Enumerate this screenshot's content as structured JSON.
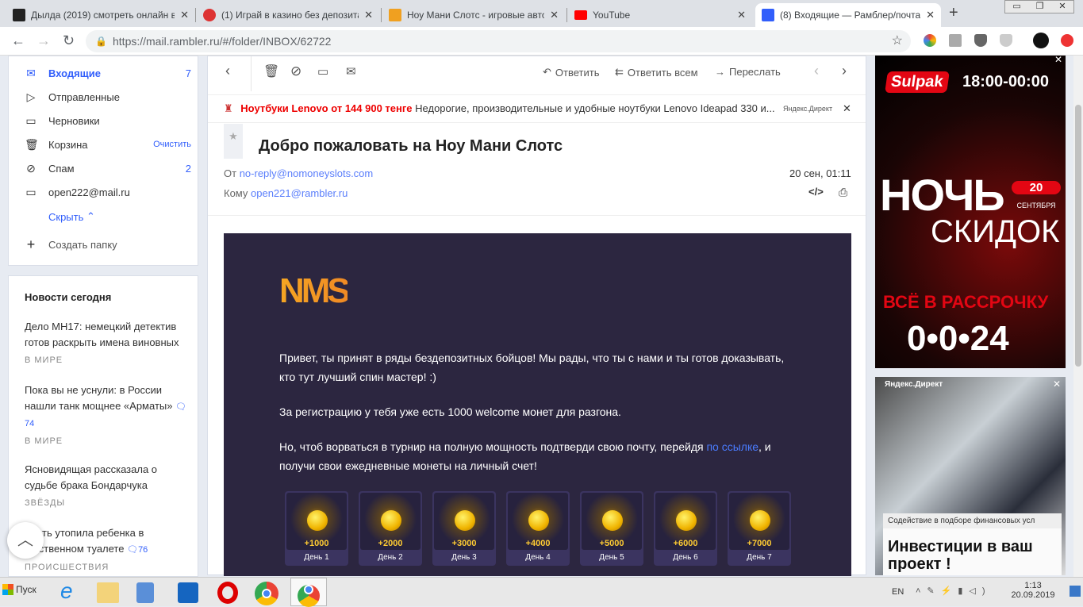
{
  "browser": {
    "tabs": [
      {
        "title": "Дылда (2019) смотреть онлайн в",
        "color": "#222"
      },
      {
        "title": "(1) Играй в казино без депозита",
        "color": "#d33"
      },
      {
        "title": "Ноу Мани Слотс - игровые автома",
        "color": "#f0a020"
      },
      {
        "title": "YouTube",
        "color": "#f00"
      },
      {
        "title": "(8) Входящие — Рамблер/почта",
        "color": "#315efb"
      }
    ],
    "url_host": "https://mail.rambler.ru",
    "url_path": "/#/folder/INBOX/62722"
  },
  "folders": [
    {
      "label": "Входящие",
      "count": "7",
      "icon": "inbox-icon"
    },
    {
      "label": "Отправленные",
      "icon": "sent-icon"
    },
    {
      "label": "Черновики",
      "icon": "drafts-icon"
    },
    {
      "label": "Корзина",
      "action": "Очистить",
      "icon": "trash-icon"
    },
    {
      "label": "Спам",
      "count": "2",
      "icon": "spam-icon"
    },
    {
      "label": "open222@mail.ru",
      "icon": "folder-icon"
    }
  ],
  "hide_label": "Скрыть",
  "create_folder": "Создать папку",
  "news": {
    "title": "Новости сегодня",
    "items": [
      {
        "text": "Дело МН17: немецкий детектив готов раскрыть имена виновных",
        "cat": "В МИРЕ"
      },
      {
        "text": "Пока вы не уснули: в России нашли танк мощнее «Арматы»",
        "comments": "74",
        "cat": "В МИРЕ"
      },
      {
        "text": "Ясновидящая рассказала о судьбе брака Бондарчука",
        "cat": "ЗВЁЗДЫ"
      },
      {
        "text": "ть утопила ребенка в щественном туалете",
        "comments": "76",
        "cat": "ПРОИСШЕСТВИЯ"
      }
    ]
  },
  "toolbar": {
    "reply": "Ответить",
    "reply_all": "Ответить всем",
    "forward": "Переслать"
  },
  "ad_line": {
    "title": "Ноутбуки Lenovo от 144 900 тенге",
    "text": "Недорогие, производительные и удобные ноутбуки Lenovo Ideapad 330 и...",
    "source": "Яндекс.Директ"
  },
  "message": {
    "subject": "Добро пожаловать на Ноу Мани Слотс",
    "from_label": "От",
    "from": "no-reply@nomoneyslots.com",
    "to_label": "Кому",
    "to": "open221@rambler.ru",
    "date": "20 сен, 01:11",
    "logo": "NMS",
    "p1": "Привет, ты принят в ряды бездепозитных бойцов! Мы рады, что ты с нами и ты готов доказывать, кто тут лучший спин мастер! :)",
    "p2": "За регистрацию у тебя уже есть 1000 welcome монет для разгона.",
    "p3a": "Но, чтоб ворваться в турнир на полную мощность подтверди свою почту, перейдя ",
    "p3link": "по ссылке",
    "p3b": ", и получи свои ежедневные монеты на личный счет!",
    "rewards": [
      {
        "amount": "+1000",
        "day": "День 1"
      },
      {
        "amount": "+2000",
        "day": "День 2"
      },
      {
        "amount": "+3000",
        "day": "День 3"
      },
      {
        "amount": "+4000",
        "day": "День 4"
      },
      {
        "amount": "+5000",
        "day": "День 5"
      },
      {
        "amount": "+6000",
        "day": "День 6"
      },
      {
        "amount": "+7000",
        "day": "День 7"
      }
    ]
  },
  "ad1": {
    "brand": "Sulpak",
    "hours": "18:00-00:00",
    "big1": "НОЧЬ",
    "day": "20",
    "month": "СЕНТЯБРЯ",
    "big2": "СКИДОК",
    "line": "ВСЁ В РАССРОЧКУ",
    "plan": "0•0•24"
  },
  "ad2": {
    "source": "Яндекс.Директ",
    "caption": "Содействие в подборе финансовых усл",
    "headline": "Инвестиции в ваш проект !"
  },
  "taskbar": {
    "start": "Пуск",
    "lang": "EN",
    "time": "1:13",
    "date": "20.09.2019"
  }
}
